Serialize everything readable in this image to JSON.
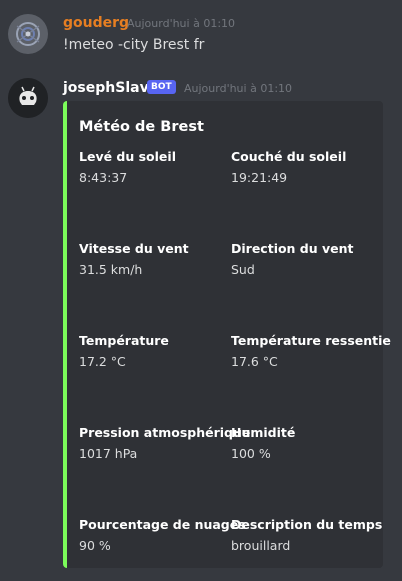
{
  "messages": [
    {
      "username": "gouderg",
      "timestamp": "Aujourd'hui à 01:10",
      "content": "!meteo -city Brest fr",
      "name_color": "#e67e22"
    },
    {
      "username": "josephSlave",
      "bot_tag": "BOT",
      "timestamp": "Aujourd'hui à 01:10",
      "name_color": "#ffffff",
      "embed": {
        "accent_color": "#7cfc5a",
        "title": "Météo de Brest",
        "fields": [
          {
            "name": "Levé du soleil",
            "value": "8:43:37"
          },
          {
            "name": "Couché du soleil",
            "value": "19:21:49"
          },
          {
            "name": "Vitesse du vent",
            "value": "31.5 km/h"
          },
          {
            "name": "Direction du vent",
            "value": "Sud"
          },
          {
            "name": "Température",
            "value": "17.2 °C"
          },
          {
            "name": "Température ressentie",
            "value": "17.6 °C"
          },
          {
            "name": "Pression atmosphérique",
            "value": "1017 hPa"
          },
          {
            "name": "Humidité",
            "value": "100 %"
          },
          {
            "name": "Pourcentage de nuages",
            "value": "90 %"
          },
          {
            "name": "Description du temps",
            "value": "brouillard"
          }
        ]
      }
    }
  ]
}
